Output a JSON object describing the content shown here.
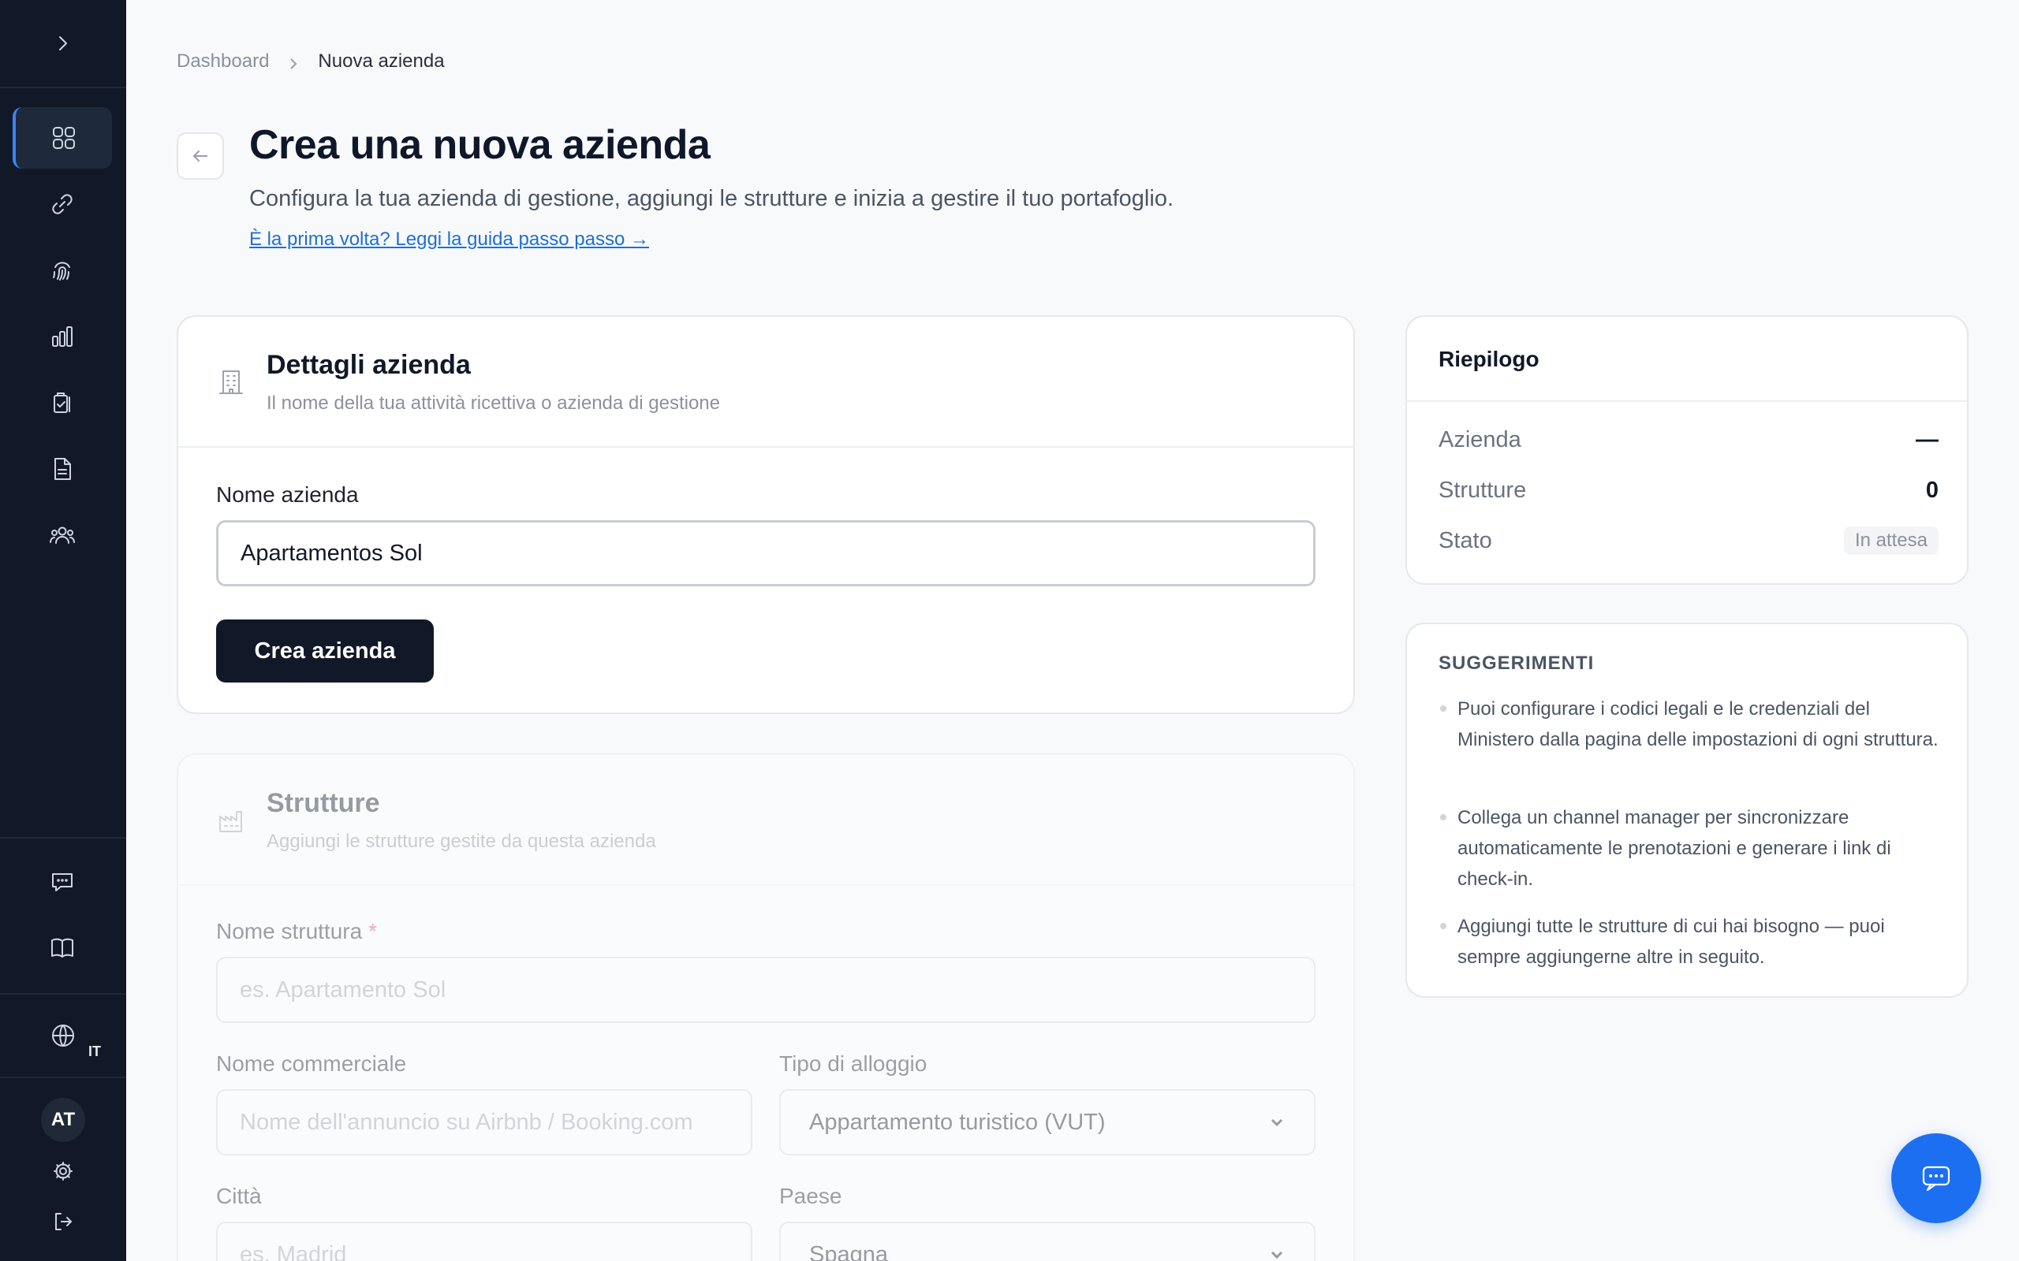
{
  "sidebar": {
    "expand_icon": "chevron-right-icon",
    "nav_items": [
      {
        "icon": "grid-icon",
        "active": true
      },
      {
        "icon": "link-icon",
        "active": false
      },
      {
        "icon": "fingerprint-icon",
        "active": false
      },
      {
        "icon": "bar-chart-icon",
        "active": false
      },
      {
        "icon": "clipboard-check-icon",
        "active": false
      },
      {
        "icon": "document-icon",
        "active": false
      },
      {
        "icon": "users-icon",
        "active": false
      }
    ],
    "bottom_items": [
      {
        "icon": "message-icon"
      },
      {
        "icon": "book-icon"
      }
    ],
    "language": "IT",
    "avatar_initials": "AT",
    "accent_color": "#3b82f6"
  },
  "breadcrumb": {
    "parent": "Dashboard",
    "current": "Nuova azienda"
  },
  "header": {
    "title": "Crea una nuova azienda",
    "subtitle": "Configura la tua azienda di gestione, aggiungi le strutture e inizia a gestire il tuo portafoglio.",
    "guide_link": "È la prima volta? Leggi la guida passo passo →"
  },
  "company_card": {
    "title": "Dettagli azienda",
    "description": "Il nome della tua attività ricettiva o azienda di gestione",
    "field_label": "Nome azienda",
    "field_value": "Apartamentos Sol",
    "submit_label": "Crea azienda"
  },
  "structures_card": {
    "title": "Strutture",
    "description": "Aggiungi le strutture gestite da questa azienda",
    "name_label": "Nome struttura",
    "required_mark": "*",
    "name_placeholder": "es. Apartamento Sol",
    "commercial_label": "Nome commerciale",
    "commercial_placeholder": "Nome dell'annuncio su Airbnb / Booking.com",
    "type_label": "Tipo di alloggio",
    "type_value": "Appartamento turistico (VUT)",
    "city_label": "Città",
    "city_placeholder": "es. Madrid",
    "country_label": "Paese",
    "country_value": "Spagna"
  },
  "summary": {
    "title": "Riepilogo",
    "company_label": "Azienda",
    "company_value": "—",
    "structures_label": "Strutture",
    "structures_value": "0",
    "status_label": "Stato",
    "status_value": "In attesa"
  },
  "tips": {
    "title": "SUGGERIMENTI",
    "items": [
      "Puoi configurare i codici legali e le credenziali del Ministero dalla pagina delle impostazioni di ogni struttura.",
      "Collega un channel manager per sincronizzare automaticamente le prenotazioni e generare i link di check-in.",
      "Aggiungi tutte le strutture di cui hai bisogno — puoi sempre aggiungerne altre in seguito."
    ]
  },
  "chat": {
    "icon": "chat-icon",
    "color": "#1d6ff2"
  }
}
